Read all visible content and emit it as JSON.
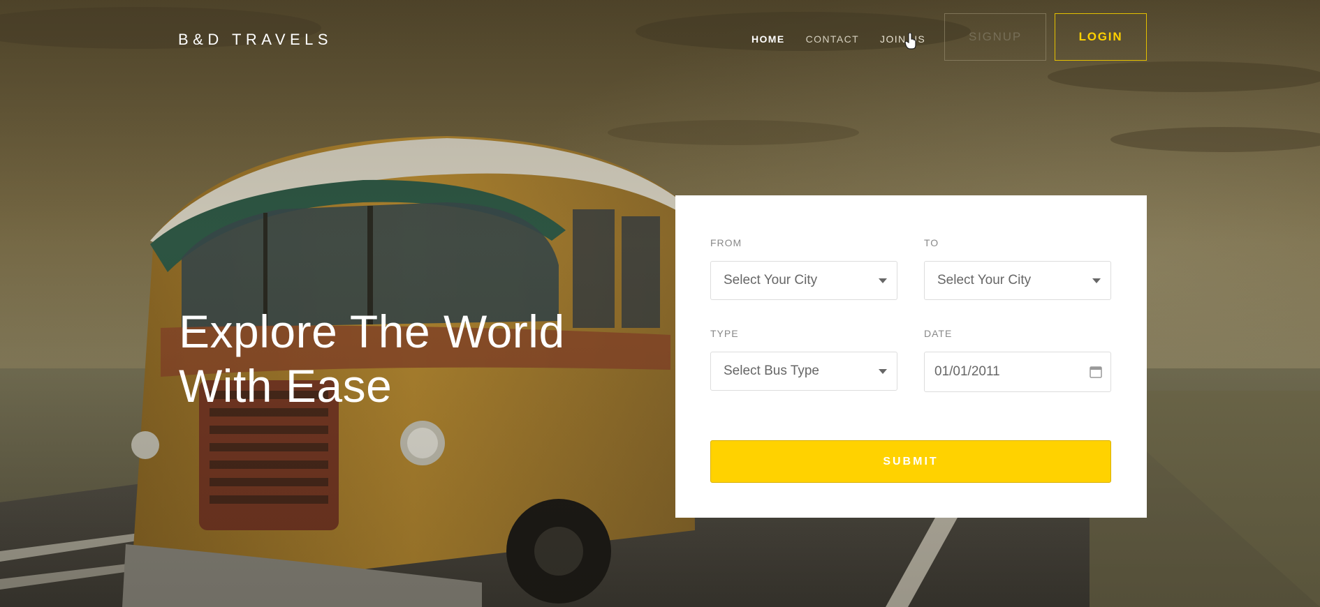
{
  "header": {
    "brand": "B&D TRAVELS",
    "nav": [
      {
        "label": "HOME"
      },
      {
        "label": "CONTACT"
      },
      {
        "label": "JOIN US"
      }
    ],
    "signup_label": "SIGNUP",
    "login_label": "LOGIN"
  },
  "hero": {
    "headline_line1": "Explore The World",
    "headline_line2": "With Ease"
  },
  "form": {
    "from": {
      "label": "FROM",
      "value": "Select Your City"
    },
    "to": {
      "label": "TO",
      "value": "Select Your City"
    },
    "type": {
      "label": "TYPE",
      "value": "Select Bus Type"
    },
    "date": {
      "label": "DATE",
      "value": "01/01/2011"
    },
    "submit_label": "SUBMIT"
  },
  "colors": {
    "accent": "#ffd200",
    "card_bg": "#ffffff",
    "text_on_dark": "#ffffff"
  }
}
